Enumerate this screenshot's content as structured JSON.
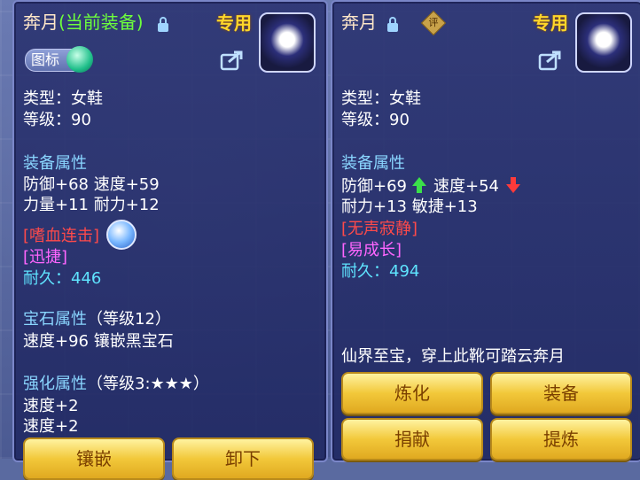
{
  "left": {
    "title": "奔月",
    "current_tag": "(当前装备)",
    "exclusive": "专用",
    "tag_button": "图标",
    "type": "类型：女鞋",
    "level": "等级：90",
    "equip_header": "装备属性",
    "stats1": "防御+68 速度+59",
    "stats2": "力量+11 耐力+12",
    "skill1": "[嗜血连击]",
    "skill2": "[迅捷]",
    "durability": "耐久：446",
    "gem_header": "宝石属性",
    "gem_level": "（等级12）",
    "gem_stat": "速度+96 镶嵌黑宝石",
    "enh_header": "强化属性",
    "enh_level": "（等级3:★★★）",
    "enh_stat1": "速度+2",
    "enh_stat2": "速度+2",
    "btn_inlay": "镶嵌",
    "btn_unequip": "卸下"
  },
  "right": {
    "title": "奔月",
    "appraise": "评",
    "exclusive": "专用",
    "type": "类型：女鞋",
    "level": "等级：90",
    "equip_header": "装备属性",
    "stat_def": "防御+69",
    "stat_spd": "速度+54",
    "stats2": "耐力+13 敏捷+13",
    "skill1": "[无声寂静]",
    "skill2": "[易成长]",
    "durability": "耐久：494",
    "description": "仙界至宝，穿上此靴可踏云奔月",
    "btn_refine": "炼化",
    "btn_equip": "装备",
    "btn_donate": "捐献",
    "btn_extract": "提炼"
  },
  "icons": {
    "lock": "lock-icon",
    "share": "share-icon",
    "avatar": "character-portrait-icon",
    "skill": "skill-orb-icon",
    "up": "stat-up-arrow-icon",
    "down": "stat-down-arrow-icon"
  },
  "colors": {
    "accent_gold": "#ffd62a",
    "stat_header": "#8ad6ff",
    "skill_red": "#ff4a4a",
    "skill_purple": "#ff66ff",
    "durability": "#5fe4ff",
    "increase": "#3be04a",
    "decrease": "#ff3a3a"
  }
}
